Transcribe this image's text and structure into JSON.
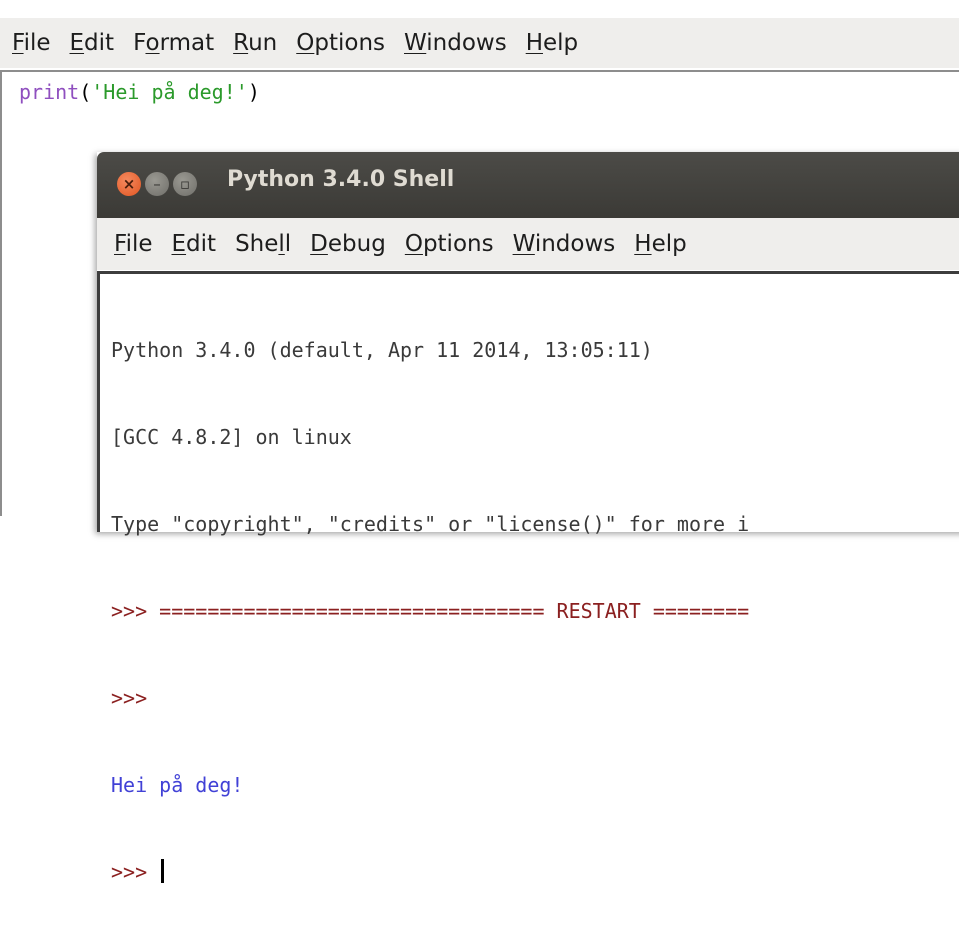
{
  "editor": {
    "menu": [
      {
        "pre": "",
        "u": "F",
        "post": "ile"
      },
      {
        "pre": "",
        "u": "E",
        "post": "dit"
      },
      {
        "pre": "F",
        "u": "o",
        "post": "rmat"
      },
      {
        "pre": "",
        "u": "R",
        "post": "un"
      },
      {
        "pre": "",
        "u": "O",
        "post": "ptions"
      },
      {
        "pre": "",
        "u": "W",
        "post": "indows"
      },
      {
        "pre": "",
        "u": "H",
        "post": "elp"
      }
    ],
    "code": {
      "builtin": "print",
      "open": "(",
      "string": "'Hei på deg!'",
      "close": ")"
    }
  },
  "shell": {
    "title": "Python 3.4.0 Shell",
    "buttons": {
      "close": "×",
      "minimize": "–",
      "maximize": "▫"
    },
    "menu": [
      {
        "pre": "",
        "u": "F",
        "post": "ile"
      },
      {
        "pre": "",
        "u": "E",
        "post": "dit"
      },
      {
        "pre": "She",
        "u": "l",
        "post": "l"
      },
      {
        "pre": "",
        "u": "D",
        "post": "ebug"
      },
      {
        "pre": "",
        "u": "O",
        "post": "ptions"
      },
      {
        "pre": "",
        "u": "W",
        "post": "indows"
      },
      {
        "pre": "",
        "u": "H",
        "post": "elp"
      }
    ],
    "lines": {
      "l1": "Python 3.4.0 (default, Apr 11 2014, 13:05:11)",
      "l2": "[GCC 4.8.2] on linux",
      "l3": "Type \"copyright\", \"credits\" or \"license()\" for more i",
      "l4_prompt": ">>> ",
      "l4_text": "================================ RESTART ========",
      "l5_prompt": ">>>",
      "l6": "Hei på deg!",
      "l7_prompt": ">>> "
    }
  }
}
